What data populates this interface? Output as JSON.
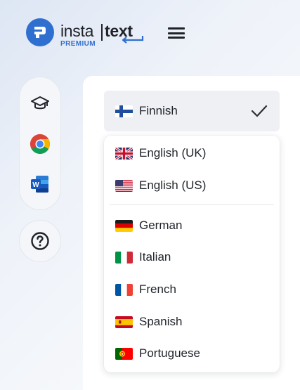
{
  "brand": {
    "name_part1": "insta",
    "name_part2": "text",
    "tier": "PREMIUM",
    "accent_color": "#2f6fd0"
  },
  "header": {
    "menu_icon": "hamburger-menu-icon"
  },
  "sidebar": {
    "items": [
      {
        "name": "graduation-cap-icon"
      },
      {
        "name": "chrome-icon"
      },
      {
        "name": "word-icon"
      }
    ],
    "help_icon": "question-circle-icon"
  },
  "language_select": {
    "selected": "Finnish",
    "selected_flag": "fi-flag-icon",
    "check_icon": "checkmark-icon"
  },
  "dropdown": {
    "options": [
      {
        "label": "English (UK)",
        "flag": "gb-flag-icon"
      },
      {
        "label": "English (US)",
        "flag": "us-flag-icon"
      },
      {
        "label": "German",
        "flag": "de-flag-icon"
      },
      {
        "label": "Italian",
        "flag": "it-flag-icon"
      },
      {
        "label": "French",
        "flag": "fr-flag-icon"
      },
      {
        "label": "Spanish",
        "flag": "es-flag-icon"
      },
      {
        "label": "Portuguese",
        "flag": "pt-flag-icon"
      }
    ]
  }
}
